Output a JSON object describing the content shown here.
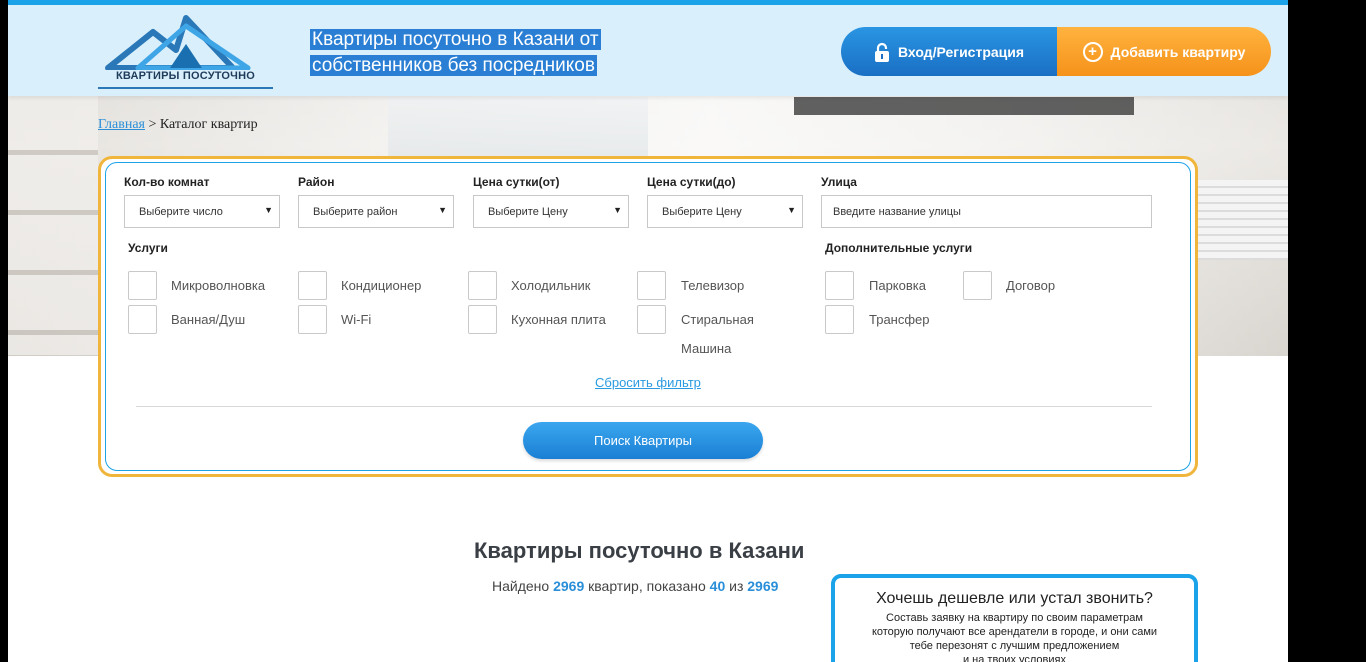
{
  "header": {
    "logo_text": "КВАРТИРЫ ПОСУТОЧНО",
    "tagline_line1": "Квартиры посуточно в Казани от",
    "tagline_line2": "собственников без посредников",
    "login_label": "Вход/Регистрация",
    "add_label": "Добавить квартиру"
  },
  "breadcrumb": {
    "home": "Главная",
    "separator": ">",
    "current": "Каталог квартир"
  },
  "filter": {
    "rooms": {
      "label": "Кол-во комнат",
      "value": "Выберите число"
    },
    "district": {
      "label": "Район",
      "value": "Выберите район"
    },
    "price_from": {
      "label": "Цена сутки(от)",
      "value": "Выберите Цену"
    },
    "price_to": {
      "label": "Цена сутки(до)",
      "value": "Выберите Цену"
    },
    "street": {
      "label": "Улица",
      "placeholder": "Введите название улицы"
    },
    "services_title": "Услуги",
    "extra_title": "Дополнительные услуги",
    "services": [
      "Микроволновка",
      "Кондиционер",
      "Холодильник",
      "Телевизор",
      "Ванная/Душ",
      "Wi-Fi",
      "Кухонная плита",
      "Стиральная",
      "Машина"
    ],
    "extras": [
      "Парковка",
      "Договор",
      "Трансфер"
    ],
    "reset_label": "Сбросить фильтр",
    "search_label": "Поиск Квартиры"
  },
  "main": {
    "title": "Квартиры посуточно в Казани",
    "found_prefix": "Найдено",
    "found_total": "2969",
    "found_mid": "квартир, показано",
    "shown": "40",
    "of": "из",
    "total2": "2969"
  },
  "promo": {
    "title": "Хочешь дешевле или устал звонить?",
    "line1": "Составь заявку на квартиру по своим параметрам",
    "line2": "которую получают все арендатели в городе, и они сами",
    "line3": "тебе перезонят с лучшим предложением",
    "line4": "и на твоих условиях"
  },
  "colors": {
    "accent_blue": "#1aa3e8",
    "accent_orange": "#f5921a",
    "filter_border": "#f0b63c"
  }
}
